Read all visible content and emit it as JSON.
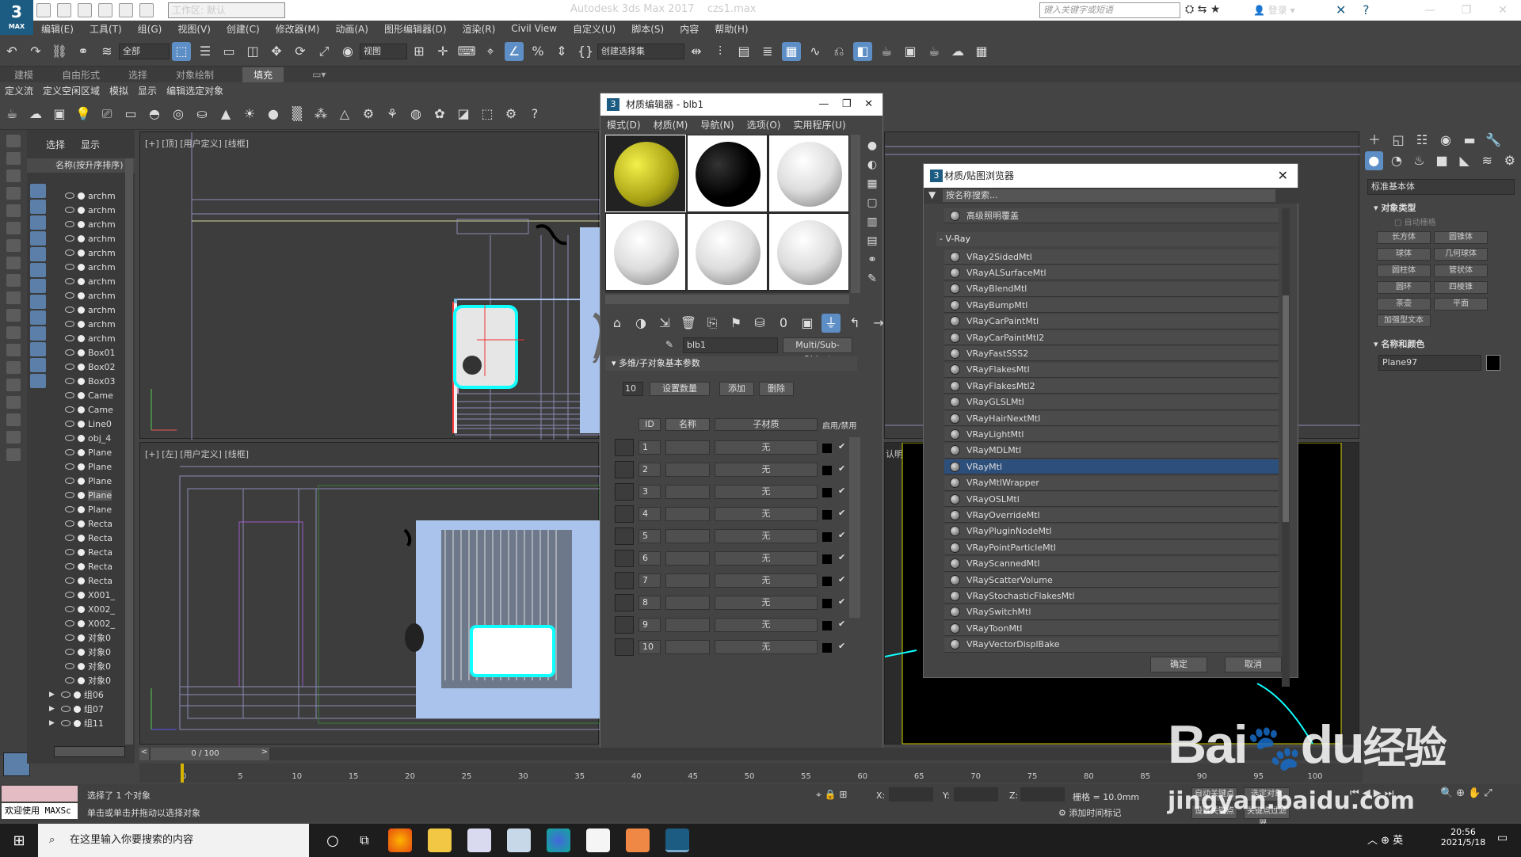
{
  "titlebar": {
    "workspace": "工作区: 默认",
    "app_title": "Autodesk 3ds Max 2017",
    "file_name": "czs1.max",
    "search_placeholder": "键入关键字或短语",
    "login": "登录"
  },
  "logo": {
    "text": "3",
    "sub": "MAX"
  },
  "menu": [
    "编辑(E)",
    "工具(T)",
    "组(G)",
    "视图(V)",
    "创建(C)",
    "修改器(M)",
    "动画(A)",
    "图形编辑器(D)",
    "渲染(R)",
    "Civil View",
    "自定义(U)",
    "脚本(S)",
    "内容",
    "帮助(H)"
  ],
  "toolbar": {
    "filter": "全部",
    "coord": "视图",
    "selection_set": "创建选择集"
  },
  "ribbon": {
    "tabs": [
      "建模",
      "自由形式",
      "选择",
      "对象绘制",
      "填充"
    ],
    "active": "填充",
    "scene_tools": [
      "定义流",
      "定义空闲区域",
      "模拟",
      "显示",
      "编辑选定对象"
    ]
  },
  "explorer": {
    "tabs": [
      "选择",
      "显示"
    ],
    "header": "名称(按升序排序)",
    "items": [
      "archm",
      "archm",
      "archm",
      "archm",
      "archm",
      "archm",
      "archm",
      "archm",
      "archm",
      "archm",
      "archm",
      "Box01",
      "Box02",
      "Box03",
      "Came",
      "Came",
      "Line0",
      "obj_4",
      "Plane",
      "Plane",
      "Plane",
      "Plane",
      "Plane",
      "Recta",
      "Recta",
      "Recta",
      "Recta",
      "Recta",
      "X001_",
      "X002_",
      "X002_",
      "对象0",
      "对象0",
      "对象0",
      "对象0",
      "组06",
      "组07",
      "组11"
    ]
  },
  "viewports": {
    "top_label": "[+] [顶] [用户定义] [线框]",
    "left_label": "[+] [左] [用户定义] [线框]",
    "right_partial": "认明暗处理"
  },
  "material_editor": {
    "title": "材质编辑器 - blb1",
    "menu": [
      "模式(D)",
      "材质(M)",
      "导航(N)",
      "选项(O)",
      "实用程序(U)"
    ],
    "material_name": "blb1",
    "material_type": "Multi/Sub-Object",
    "rollout": "多维/子对象基本参数",
    "count": "10",
    "set_count": "设置数量",
    "add": "添加",
    "delete": "删除",
    "headers": {
      "id": "ID",
      "name": "名称",
      "sub": "子材质",
      "enable": "启用/禁用"
    },
    "rows": [
      {
        "id": "1",
        "sub": "无"
      },
      {
        "id": "2",
        "sub": "无"
      },
      {
        "id": "3",
        "sub": "无"
      },
      {
        "id": "4",
        "sub": "无"
      },
      {
        "id": "5",
        "sub": "无"
      },
      {
        "id": "6",
        "sub": "无"
      },
      {
        "id": "7",
        "sub": "无"
      },
      {
        "id": "8",
        "sub": "无"
      },
      {
        "id": "9",
        "sub": "无"
      },
      {
        "id": "10",
        "sub": "无"
      }
    ]
  },
  "browser": {
    "title": "材质/贴图浏览器",
    "search_placeholder": "按名称搜索...",
    "prev_item": "高级照明覆盖",
    "group": "- V-Ray",
    "items": [
      "VRay2SidedMtl",
      "VRayALSurfaceMtl",
      "VRayBlendMtl",
      "VRayBumpMtl",
      "VRayCarPaintMtl",
      "VRayCarPaintMtl2",
      "VRayFastSSS2",
      "VRayFlakesMtl",
      "VRayFlakesMtl2",
      "VRayGLSLMtl",
      "VRayHairNextMtl",
      "VRayLightMtl",
      "VRayMDLMtl",
      "VRayMtl",
      "VRayMtlWrapper",
      "VRayOSLMtl",
      "VRayOverrideMtl",
      "VRayPluginNodeMtl",
      "VRayPointParticleMtl",
      "VRayScannedMtl",
      "VRayScatterVolume",
      "VRayStochasticFlakesMtl",
      "VRaySwitchMtl",
      "VRayToonMtl",
      "VRayVectorDisplBake"
    ],
    "selected": "VRayMtl",
    "ok": "确定",
    "cancel": "取消"
  },
  "command_panel": {
    "dropdown": "标准基本体",
    "section_object_type": "对象类型",
    "auto_grid": "自动栅格",
    "buttons": [
      "长方体",
      "圆锥体",
      "球体",
      "几何球体",
      "圆柱体",
      "管状体",
      "圆环",
      "四棱锥",
      "茶壶",
      "平面",
      "加强型文本"
    ],
    "section_name_color": "名称和颜色",
    "object_name": "Plane97"
  },
  "timeline": {
    "frame": "0 / 100",
    "ticks": [
      "0",
      "5",
      "10",
      "15",
      "20",
      "25",
      "30",
      "35",
      "40",
      "45",
      "50",
      "55",
      "60",
      "65",
      "70",
      "75",
      "80",
      "85",
      "90",
      "95",
      "100"
    ]
  },
  "status": {
    "welcome": "欢迎使用 MAXSc",
    "selected": "选择了 1 个对象",
    "hint": "单击或单击并拖动以选择对象",
    "x": "X:",
    "y": "Y:",
    "z": "Z:",
    "grid": "栅格 = 10.0mm",
    "add_time_tag": "添加时间标记",
    "auto_key": "自动关键点",
    "selected_objects": "选定对象",
    "set_key": "设置关键点",
    "key_filters": "关键点过滤器..."
  },
  "taskbar": {
    "search": "在这里输入你要搜索的内容",
    "time": "20:56",
    "date": "2021/5/18",
    "ime": "英"
  },
  "watermark": {
    "brand": "Bai",
    "brand2": "du",
    "cn": "经验",
    "url": "jingyan.baidu.com"
  },
  "colors": {
    "accent": "#5d8ec6",
    "selected": "#2c4f7c",
    "viewport_bg": "#3d3d3d",
    "curtain": "#a9c3ec"
  }
}
